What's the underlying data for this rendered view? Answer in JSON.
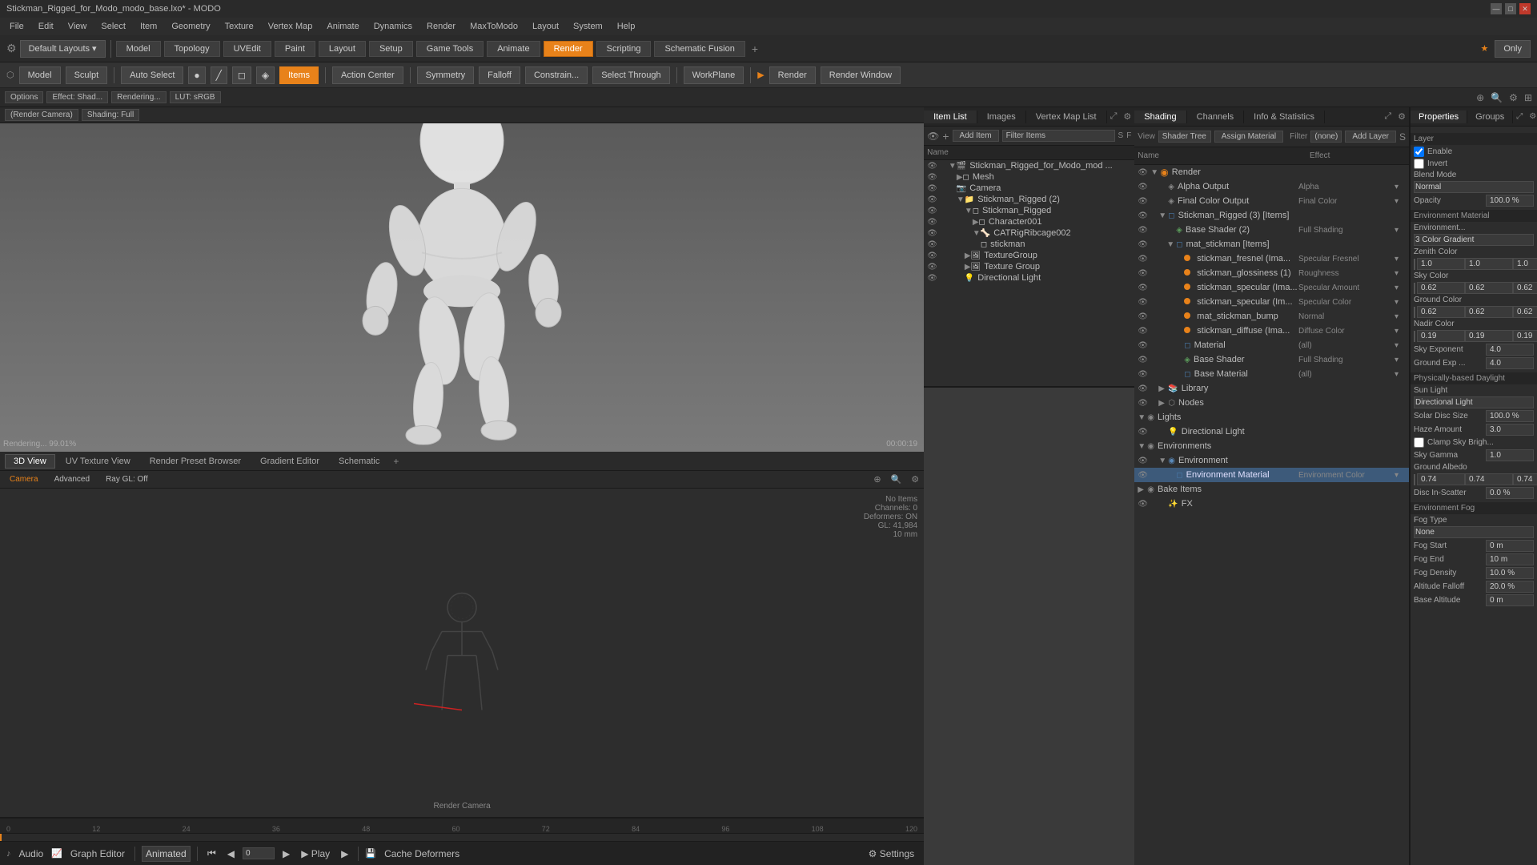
{
  "titlebar": {
    "title": "Stickman_Rigged_for_Modo_modo_base.lxo* - MODO",
    "controls": [
      "—",
      "□",
      "✕"
    ]
  },
  "menubar": {
    "items": [
      "File",
      "Edit",
      "View",
      "Select",
      "Item",
      "Geometry",
      "Texture",
      "Vertex Map",
      "Animate",
      "Dynamics",
      "Render",
      "MaxToModo",
      "Layout",
      "System",
      "Help"
    ]
  },
  "topbar": {
    "layout_label": "Default Layouts",
    "mode_buttons": [
      "Model",
      "Topology",
      "UVEdit",
      "Paint",
      "Layout",
      "Setup",
      "Game Tools",
      "Animate",
      "Render",
      "Scripting",
      "Schematic Fusion"
    ],
    "only_btn": "Only",
    "star_icon": "★"
  },
  "toolbar": {
    "mode_btn": "Model",
    "sculpt_btn": "Sculpt",
    "auto_select_btn": "Auto Select",
    "action_center_btn": "Action Center",
    "symmetry_btn": "Symmetry",
    "falloff_btn": "Falloff",
    "constraint_btn": "Constrain...",
    "select_through_btn": "Select Through",
    "work_plane_btn": "WorkPlane",
    "render_btn": "Render",
    "render_window_btn": "Render Window",
    "items_btn": "Items"
  },
  "viewport_options": {
    "options_btn": "Options",
    "effect_btn": "Effect:",
    "shading_btn": "Shad...",
    "rendering_btn": "Rendering...",
    "lut_btn": "LUT: sRGB",
    "render_camera_btn": "(Render Camera)",
    "shading_full_btn": "Shading: Full"
  },
  "item_list": {
    "tabs": [
      "Item List",
      "Images",
      "Vertex Map List"
    ],
    "add_item_btn": "Add Item",
    "filter_items_btn": "Filter Items",
    "name_col": "Name",
    "items": [
      {
        "id": "root",
        "name": "Stickman_Rigged_for_Modo_mod ...",
        "indent": 0,
        "type": "scene",
        "expanded": true
      },
      {
        "id": "mesh",
        "name": "Mesh",
        "indent": 1,
        "type": "mesh",
        "expanded": false
      },
      {
        "id": "camera",
        "name": "Camera",
        "indent": 1,
        "type": "camera",
        "expanded": false
      },
      {
        "id": "stickman_rigged_grp",
        "name": "Stickman_Rigged (2)",
        "indent": 1,
        "type": "group",
        "expanded": true
      },
      {
        "id": "stickman_rigged",
        "name": "Stickman_Rigged",
        "indent": 2,
        "type": "mesh",
        "expanded": true
      },
      {
        "id": "character001",
        "name": "Character001",
        "indent": 3,
        "type": "mesh",
        "expanded": false
      },
      {
        "id": "catrigribcage002",
        "name": "CATRigRibcage002",
        "indent": 3,
        "type": "bone",
        "expanded": false
      },
      {
        "id": "stickman",
        "name": "stickman",
        "indent": 4,
        "type": "mesh",
        "expanded": false
      },
      {
        "id": "texturegroup",
        "name": "TextureGroup",
        "indent": 2,
        "type": "texture",
        "expanded": false
      },
      {
        "id": "texture_group2",
        "name": "Texture Group",
        "indent": 2,
        "type": "texture",
        "expanded": false
      },
      {
        "id": "directional_light",
        "name": "Directional Light",
        "indent": 2,
        "type": "light",
        "expanded": false
      }
    ]
  },
  "shader_tree": {
    "tabs": [
      "Shading",
      "Channels",
      "Info & Statistics"
    ],
    "view_label": "View",
    "view_select": "Shader Tree",
    "assign_material_btn": "Assign Material",
    "filter_label": "Filter",
    "filter_select": "(none)",
    "add_layer_btn": "Add Layer",
    "name_col": "Name",
    "effect_col": "Effect",
    "items": [
      {
        "id": "render",
        "name": "Render",
        "indent": 0,
        "type": "render",
        "expanded": true,
        "effect": ""
      },
      {
        "id": "alpha_output",
        "name": "Alpha Output",
        "indent": 1,
        "type": "output",
        "expanded": false,
        "effect": "Alpha"
      },
      {
        "id": "final_color_output",
        "name": "Final Color Output",
        "indent": 1,
        "type": "output",
        "expanded": false,
        "effect": "Final Color"
      },
      {
        "id": "stickman_rigged_mat",
        "name": "Stickman_Rigged (3) [Items]",
        "indent": 1,
        "type": "material",
        "expanded": true,
        "effect": ""
      },
      {
        "id": "base_shader",
        "name": "Base Shader (2)",
        "indent": 2,
        "type": "shader",
        "expanded": false,
        "effect": "Full Shading"
      },
      {
        "id": "mat_stickman",
        "name": "mat_stickman [Items]",
        "indent": 2,
        "type": "material",
        "expanded": true,
        "effect": ""
      },
      {
        "id": "stickman_fresnel",
        "name": "stickman_fresnel (Ima...",
        "indent": 3,
        "type": "texture",
        "expanded": false,
        "effect": "Specular Fresnel"
      },
      {
        "id": "stickman_glossiness",
        "name": "stickman_glossiness (1)",
        "indent": 3,
        "type": "texture",
        "expanded": false,
        "effect": "Roughness"
      },
      {
        "id": "stickman_specular1",
        "name": "stickman_specular (Ima...",
        "indent": 3,
        "type": "texture",
        "expanded": false,
        "effect": "Specular Amount"
      },
      {
        "id": "stickman_specular2",
        "name": "stickman_specular (Im...",
        "indent": 3,
        "type": "texture",
        "expanded": false,
        "effect": "Specular Color"
      },
      {
        "id": "mat_stickman_bump",
        "name": "mat_stickman_bump",
        "indent": 3,
        "type": "texture",
        "expanded": false,
        "effect": "Normal"
      },
      {
        "id": "stickman_diffuse",
        "name": "stickman_diffuse (Ima...",
        "indent": 3,
        "type": "texture",
        "expanded": false,
        "effect": "Diffuse Color"
      },
      {
        "id": "material",
        "name": "Material",
        "indent": 3,
        "type": "material",
        "expanded": false,
        "effect": "(all)"
      },
      {
        "id": "base_shader2",
        "name": "Base Shader",
        "indent": 3,
        "type": "shader",
        "expanded": false,
        "effect": "Full Shading"
      },
      {
        "id": "base_material",
        "name": "Base Material",
        "indent": 3,
        "type": "material",
        "expanded": false,
        "effect": "(all)"
      },
      {
        "id": "library",
        "name": "Library",
        "indent": 1,
        "type": "library",
        "expanded": false,
        "effect": ""
      },
      {
        "id": "nodes",
        "name": "Nodes",
        "indent": 1,
        "type": "nodes",
        "expanded": false,
        "effect": ""
      },
      {
        "id": "lights",
        "name": "Lights",
        "indent": 0,
        "type": "lights",
        "expanded": true,
        "effect": ""
      },
      {
        "id": "directional_light",
        "name": "Directional Light",
        "indent": 1,
        "type": "light",
        "expanded": false,
        "effect": ""
      },
      {
        "id": "environments",
        "name": "Environments",
        "indent": 0,
        "type": "environments",
        "expanded": true,
        "effect": ""
      },
      {
        "id": "environment",
        "name": "Environment",
        "indent": 1,
        "type": "environment",
        "expanded": true,
        "effect": ""
      },
      {
        "id": "environment_material",
        "name": "Environment Material",
        "indent": 2,
        "type": "material",
        "selected": true,
        "expanded": false,
        "effect": "Environment Color"
      },
      {
        "id": "bake_items",
        "name": "Bake Items",
        "indent": 0,
        "type": "bake",
        "expanded": false,
        "effect": ""
      },
      {
        "id": "fx",
        "name": "FX",
        "indent": 1,
        "type": "fx",
        "expanded": false,
        "effect": ""
      }
    ]
  },
  "properties": {
    "tabs": [
      "Properties",
      "Groups"
    ],
    "layer_label": "Layer",
    "enable_label": "Enable",
    "invert_label": "Invert",
    "blend_mode_label": "Blend Mode",
    "blend_mode_value": "Normal",
    "opacity_label": "Opacity",
    "opacity_value": "100.0 %",
    "environment_material_label": "Environment Material",
    "environment_label": "Environment...",
    "environment_value": "3 Color Gradient",
    "zenith_color_label": "Zenith Color",
    "zenith_color_values": [
      "1.0",
      "1.0",
      "1.0"
    ],
    "sky_color_label": "Sky Color",
    "sky_color_values": [
      "0.62",
      "0.62",
      "0.62"
    ],
    "ground_color_label": "Ground Color",
    "ground_color_values": [
      "0.62",
      "0.62",
      "0.62"
    ],
    "nadir_color_label": "Nadir Color",
    "nadir_color_values": [
      "0.19",
      "0.19",
      "0.19"
    ],
    "sky_exponent_label": "Sky Exponent",
    "sky_exponent_value": "4.0",
    "ground_exp_label": "Ground Exp ...",
    "ground_exp_value": "4.0",
    "physically_based_label": "Physically-based Daylight",
    "sun_light_label": "Sun Light",
    "sun_light_value": "Directional Light",
    "solar_disc_label": "Solar Disc Size",
    "solar_disc_value": "100.0 %",
    "haze_amount_label": "Haze Amount",
    "haze_amount_value": "3.0",
    "clamp_sky_label": "Clamp Sky Brigh...",
    "sky_gamma_label": "Sky Gamma",
    "sky_gamma_value": "1.0",
    "ground_albedo_label": "Ground Albedo",
    "ground_albedo_values": [
      "0.74",
      "0.74",
      "0.74"
    ],
    "disc_inscatter_label": "Disc In-Scatter",
    "disc_inscatter_value": "0.0 %",
    "environment_fog_label": "Environment Fog",
    "fog_type_label": "Fog Type",
    "fog_type_value": "None",
    "fog_start_label": "Fog Start",
    "fog_start_value": "0 m",
    "fog_end_label": "Fog End",
    "fog_end_value": "10 m",
    "fog_density_label": "Fog Density",
    "fog_density_value": "10.0 %",
    "altitude_falloff_label": "Altitude Falloff",
    "altitude_falloff_value": "20.0 %",
    "base_altitude_label": "Base Altitude",
    "base_altitude_value": "0 m"
  },
  "bottom_tabs": [
    "3D View",
    "UV Texture View",
    "Render Preset Browser",
    "Gradient Editor",
    "Schematic"
  ],
  "bottom_viewport": {
    "camera_label": "Render Camera",
    "camera_btn": "Camera",
    "advanced_btn": "Advanced",
    "ray_gl_btn": "Ray GL: Off",
    "stats": {
      "no_items": "No Items",
      "channels": "Channels: 0",
      "deformers": "Deformers: ON",
      "gl": "GL: 41,984",
      "size": "10 mm"
    }
  },
  "timeline": {
    "markers": [
      "0",
      "12",
      "24",
      "36",
      "48",
      "60",
      "72",
      "84",
      "96",
      "108",
      "120"
    ]
  },
  "playback": {
    "audio_btn": "Audio",
    "graph_editor_btn": "Graph Editor",
    "animated_btn": "Animated",
    "frame_input": "0",
    "play_btn": "Play",
    "cache_deformers_btn": "Cache Deformers",
    "settings_btn": "Settings"
  },
  "render_status": "Rendering... 99.01%",
  "render_timer": "00:00:19"
}
